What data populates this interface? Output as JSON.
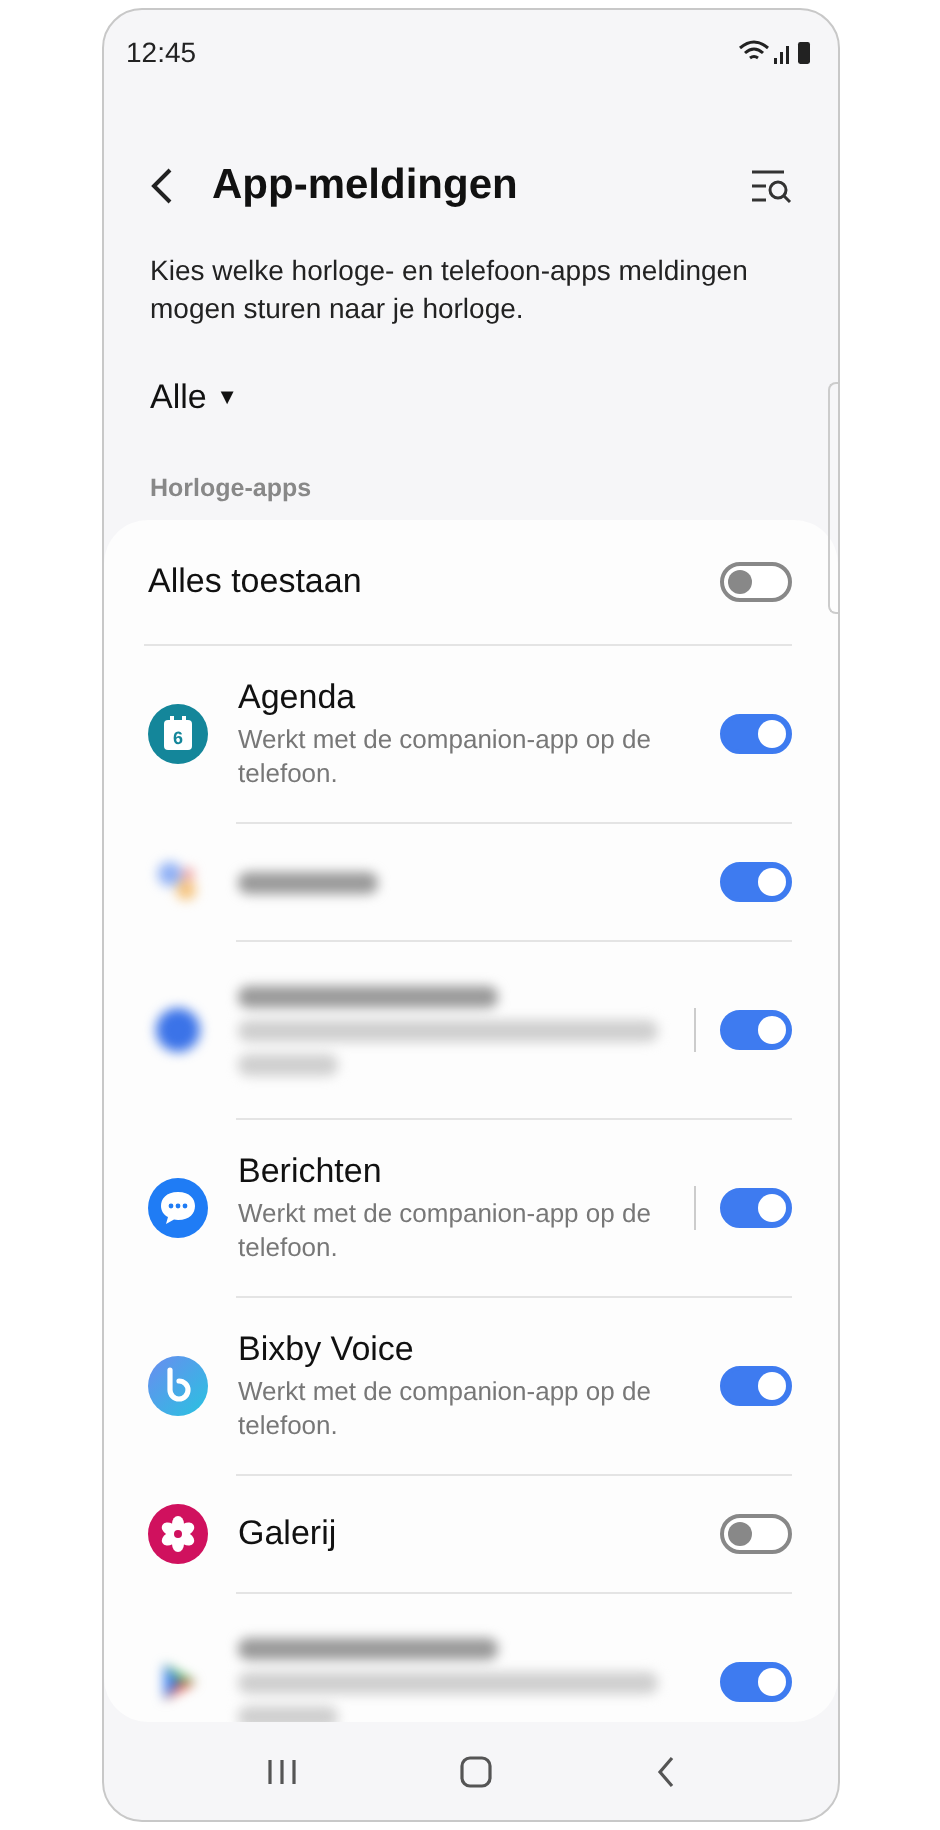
{
  "status_bar": {
    "time": "12:45"
  },
  "header": {
    "title": "App-meldingen"
  },
  "description": "Kies welke horloge- en telefoon-apps meldingen mogen sturen naar je horloge.",
  "filter": {
    "value": "Alle",
    "arrow": "▼"
  },
  "section_title": "Horloge-apps",
  "allow_all": {
    "label": "Alles toestaan",
    "on": false
  },
  "apps": [
    {
      "kind": "app",
      "icon_label": "6",
      "name": "Agenda",
      "subtitle": "Werkt met de companion-app op de telefoon.",
      "on": true,
      "divider": false
    },
    {
      "kind": "blurred",
      "has_description": false,
      "on": true,
      "divider": false
    },
    {
      "kind": "blurred",
      "has_description": true,
      "on": true,
      "divider": true
    },
    {
      "kind": "app",
      "name": "Berichten",
      "subtitle": "Werkt met de companion-app op de telefoon.",
      "on": true,
      "divider": true
    },
    {
      "kind": "app",
      "name": "Bixby Voice",
      "subtitle": "Werkt met de companion-app op de telefoon.",
      "on": true,
      "divider": false
    },
    {
      "kind": "app",
      "name": "Galerij",
      "on": false,
      "divider": false
    },
    {
      "kind": "blurred",
      "has_description": true,
      "on": true,
      "divider": false
    }
  ]
}
